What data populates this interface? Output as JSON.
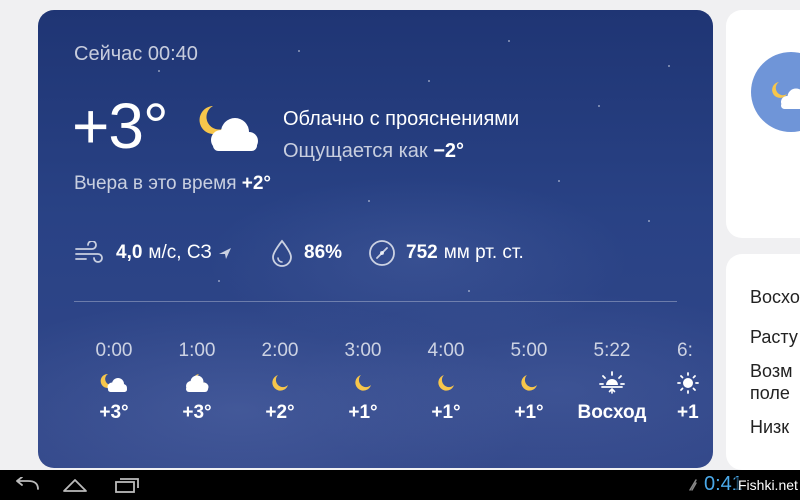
{
  "current": {
    "now_label": "Сейчас 00:40",
    "temperature": "+3°",
    "condition": "Облачно с прояснениями",
    "feels_like_label": "Ощущается как",
    "feels_like_value": "−2°",
    "yesterday_label": "Вчера в это время",
    "yesterday_value": "+2°",
    "icon": "partly-cloudy-night-icon"
  },
  "params": {
    "wind_value": "4,0",
    "wind_unit": "м/с, СЗ",
    "humidity": "86%",
    "pressure_value": "752",
    "pressure_unit": "мм рт. ст."
  },
  "hourly": [
    {
      "time": "0:00",
      "icon": "partly-cloudy-night-icon",
      "temp": "+3°"
    },
    {
      "time": "1:00",
      "icon": "cloudy-night-icon",
      "temp": "+3°"
    },
    {
      "time": "2:00",
      "icon": "moon-icon",
      "temp": "+2°"
    },
    {
      "time": "3:00",
      "icon": "moon-icon",
      "temp": "+1°"
    },
    {
      "time": "4:00",
      "icon": "moon-icon",
      "temp": "+1°"
    },
    {
      "time": "5:00",
      "icon": "moon-icon",
      "temp": "+1°"
    },
    {
      "time": "5:22",
      "icon": "sunrise-icon",
      "temp": "Восход"
    },
    {
      "time": "6:",
      "icon": "sun-icon",
      "temp": "+1"
    }
  ],
  "side_panel": {
    "lines": [
      "Восхо",
      "Расту",
      "Возм",
      "поле",
      "Низк"
    ]
  },
  "system": {
    "clock": "0:41",
    "watermark": "Fishki.net"
  },
  "colors": {
    "card_top": "#1f3574",
    "card_bottom": "#33488a",
    "moon": "#f7c64b",
    "clock": "#4aa8e8",
    "side_circle": "#6f95d8"
  }
}
